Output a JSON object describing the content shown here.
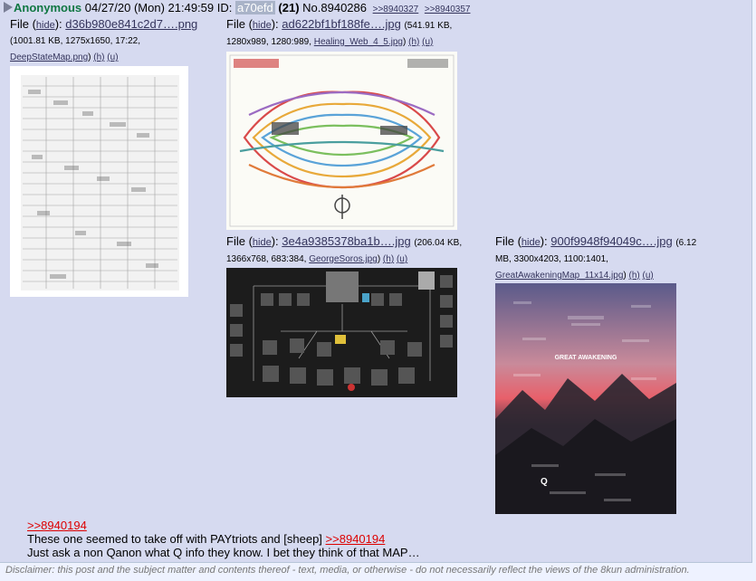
{
  "post": {
    "name": "Anonymous",
    "date": "04/27/20 (Mon) 21:49:59",
    "id_label": "ID:",
    "id_value": "a70efd",
    "id_count": "(21)",
    "post_no": "No.8940286",
    "backlinks": [
      ">>8940327",
      ">>8940357"
    ]
  },
  "files": [
    {
      "label": "File",
      "hide": "hide",
      "filename": "d36b980e841c2d7….png",
      "meta_line1": "(1001.81 KB, 1275x1650, 17:22,",
      "original": "DeepStateMap.png",
      "h": "(h)",
      "u": "(u)"
    },
    {
      "label": "File",
      "hide": "hide",
      "filename": "ad622bf1bf188fe….jpg",
      "meta_line1": "(541.91 KB,",
      "meta_line2": "1280x989, 1280:989,",
      "original": "Healing_Web_4_5.jpg",
      "h": "(h)",
      "u": "(u)"
    },
    {
      "label": "File",
      "hide": "hide",
      "filename": "3e4a9385378ba1b….jpg",
      "meta_line1": "(206.04 KB,",
      "meta_line2": "1366x768, 683:384,",
      "original": "GeorgeSoros.jpg",
      "h": "(h)",
      "u": "(u)"
    },
    {
      "label": "File",
      "hide": "hide",
      "filename": "900f9948f94049c….jpg",
      "meta_line1": "(6.12",
      "meta_line2": "MB, 3300x4203, 1100:1401,",
      "original": "GreatAwakeningMap_11x14.jpg",
      "h": "(h)",
      "u": "(u)"
    }
  ],
  "message": {
    "quote1": ">>8940194",
    "line2_text": "These one seemed to take off with PAYtriots and [sheep]",
    "quote2": ">>8940194",
    "line3": "Just ask a non Qanon what Q info they know. I bet they think of that MAP…"
  },
  "disclaimer": "Disclaimer: this post and the subject matter and contents thereof - text, media, or otherwise - do not necessarily reflect the views of the 8kun administration.",
  "colors": {
    "post_bg": "#d6daf0",
    "name": "#117743",
    "quotelink": "#dd0000",
    "link": "#34345c"
  },
  "thumb_text": {
    "great_awakening": "GREAT AWAKENING",
    "q_letter": "Q"
  }
}
